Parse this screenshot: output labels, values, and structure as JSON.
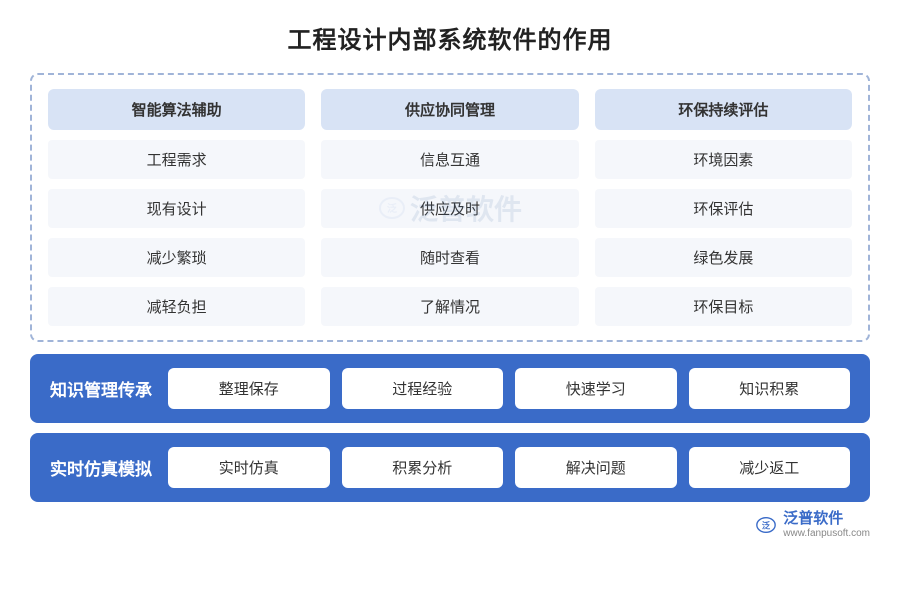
{
  "title": "工程设计内部系统软件的作用",
  "topSection": {
    "headers": [
      "智能算法辅助",
      "供应协同管理",
      "环保持续评估"
    ],
    "rows": [
      [
        "工程需求",
        "信息互通",
        "环境因素"
      ],
      [
        "现有设计",
        "供应及时",
        "环保评估"
      ],
      [
        "减少繁琐",
        "随时查看",
        "绿色发展"
      ],
      [
        "减轻负担",
        "了解情况",
        "环保目标"
      ]
    ],
    "watermark": "泛普软件"
  },
  "bottomSections": [
    {
      "label": "知识管理传承",
      "tags": [
        "整理保存",
        "过程经验",
        "快速学习",
        "知识积累"
      ]
    },
    {
      "label": "实时仿真模拟",
      "tags": [
        "实时仿真",
        "积累分析",
        "解决问题",
        "减少返工"
      ]
    }
  ],
  "logo": {
    "main": "泛普软件",
    "sub": "www.fanpusoft.com"
  }
}
